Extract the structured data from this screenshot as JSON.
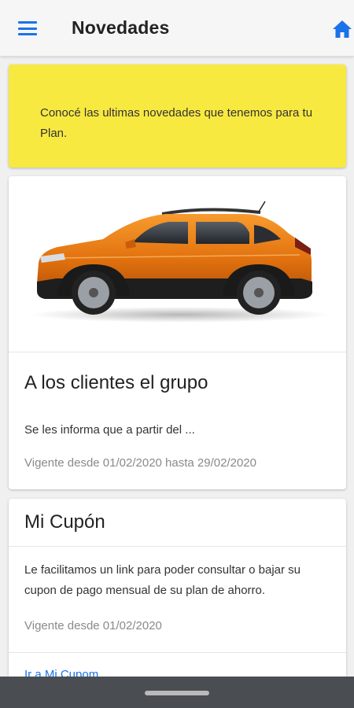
{
  "app_bar": {
    "title": "Novedades",
    "menu_icon": "hamburger-menu-icon",
    "home_icon": "home-icon",
    "accent": "#1a73e8"
  },
  "banner": {
    "text": "Conocé las ultimas novedades que tenemos para tu Plan.",
    "background": "#f8e941"
  },
  "cards": [
    {
      "image": "orange-suv-photo",
      "title": "A los clientes el grupo",
      "text": "Se les informa que a partir del ...",
      "validity": "Vigente desde 01/02/2020 hasta 29/02/2020"
    },
    {
      "title": "Mi Cupón",
      "text": "Le facilitamos un link para poder consultar o bajar su cupon de pago mensual de su plan de ahorro.",
      "validity": "Vigente desde 01/02/2020",
      "link": "Ir a Mi Cupom"
    }
  ],
  "system_nav": {
    "gesture_handle": "gesture-handle"
  }
}
